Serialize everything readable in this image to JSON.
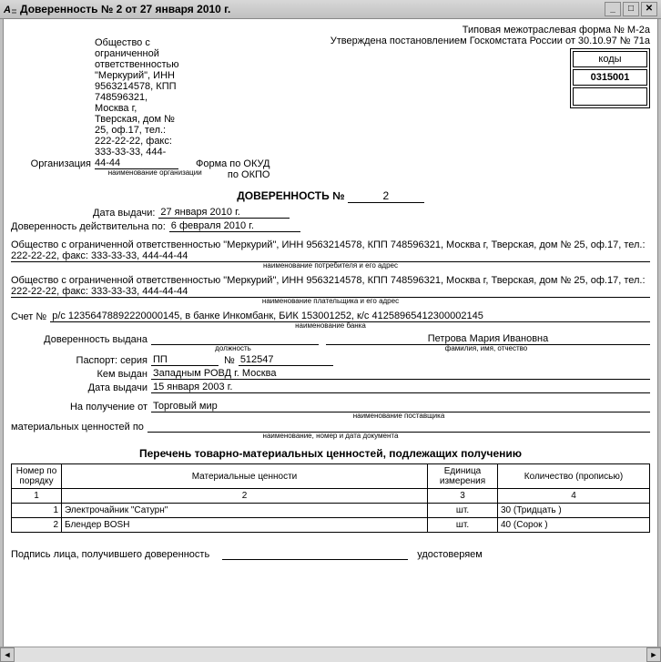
{
  "window": {
    "title": "Доверенность № 2 от 27 января 2010 г."
  },
  "header": {
    "form_type": "Типовая межотраслевая форма № М-2а",
    "approved": "Утверждена постановлением Госкомстата России от 30.10.97 № 71а",
    "codes_caption": "коды",
    "okud_label": "Форма по ОКУД",
    "okud_value": "0315001",
    "okpo_label": "по ОКПО",
    "okpo_value": ""
  },
  "org": {
    "label": "Организация",
    "text": "Общество с ограниченной ответственностью \"Меркурий\", ИНН 9563214578, КПП 748596321, Москва г, Тверская, дом № 25, оф.17, тел.: 222-22-22, факс: 333-33-33, 444-44-44",
    "hint": "наименование организации"
  },
  "doc": {
    "title": "ДОВЕРЕННОСТЬ №",
    "number": "2",
    "issue_label": "Дата выдачи:",
    "issue_value": "27 января 2010 г.",
    "valid_label": "Доверенность действительна по:",
    "valid_value": "6 февраля 2010 г."
  },
  "consumer": {
    "text": "Общество с ограниченной ответственностью \"Меркурий\", ИНН 9563214578, КПП 748596321, Москва г, Тверская, дом № 25, оф.17, тел.: 222-22-22, факс: 333-33-33, 444-44-44",
    "hint": "наименование потребителя и его адрес"
  },
  "payer": {
    "text": "Общество с ограниченной ответственностью \"Меркурий\", ИНН 9563214578, КПП 748596321, Москва г, Тверская, дом № 25, оф.17, тел.: 222-22-22, факс: 333-33-33, 444-44-44",
    "hint": "наименование плательщика и его адрес"
  },
  "account": {
    "label": "Счет №",
    "value": "р/с 12356478892220000145, в банке Инкомбанк, БИК 153001252, к/с 41258965412300002145",
    "hint": "наименование банка"
  },
  "person": {
    "issued_label": "Доверенность выдана",
    "position": "",
    "position_hint": "должность",
    "name": "Петрова Мария Ивановна",
    "name_hint": "фамилия, имя, отчество",
    "passport_label": "Паспорт: серия",
    "passport_series": "ПП",
    "passport_num_label": "№",
    "passport_num": "512547",
    "issued_by_label": "Кем выдан",
    "issued_by": "Западным РОВД г. Москва",
    "issued_date_label": "Дата выдачи",
    "issued_date": "15 января 2003 г."
  },
  "receive": {
    "from_label": "На получение от",
    "from_value": "Торговый мир",
    "from_hint": "наименование поставщика",
    "by_label": "материальных ценностей по",
    "by_value": "",
    "by_hint": "наименование, номер и дата документа"
  },
  "table": {
    "caption": "Перечень товарно-материальных ценностей, подлежащих получению",
    "cols": {
      "num": "Номер по порядку",
      "name": "Материальные ценности",
      "unit": "Единица измерения",
      "qty": "Количество (прописью)"
    },
    "colnums": [
      "1",
      "2",
      "3",
      "4"
    ],
    "rows": [
      {
        "num": "1",
        "name": "Электрочайник \"Сатурн\"",
        "unit": "шт.",
        "qty": "30 (Тридцать )"
      },
      {
        "num": "2",
        "name": "Блендер BOSH",
        "unit": "шт.",
        "qty": "40 (Сорок )"
      }
    ]
  },
  "footer": {
    "sign_label": "Подпись лица, получившего доверенность",
    "confirm_label": "удостоверяем"
  }
}
